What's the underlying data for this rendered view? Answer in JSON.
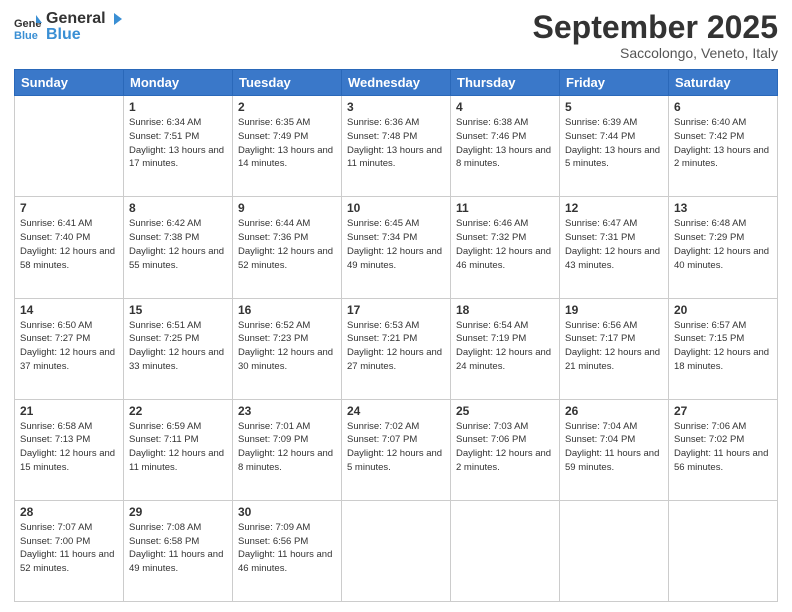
{
  "logo": {
    "general": "General",
    "blue": "Blue"
  },
  "header": {
    "month": "September 2025",
    "location": "Saccolongo, Veneto, Italy"
  },
  "days_of_week": [
    "Sunday",
    "Monday",
    "Tuesday",
    "Wednesday",
    "Thursday",
    "Friday",
    "Saturday"
  ],
  "weeks": [
    [
      {
        "day": null,
        "info": null
      },
      {
        "day": "1",
        "sunrise": "Sunrise: 6:34 AM",
        "sunset": "Sunset: 7:51 PM",
        "daylight": "Daylight: 13 hours and 17 minutes."
      },
      {
        "day": "2",
        "sunrise": "Sunrise: 6:35 AM",
        "sunset": "Sunset: 7:49 PM",
        "daylight": "Daylight: 13 hours and 14 minutes."
      },
      {
        "day": "3",
        "sunrise": "Sunrise: 6:36 AM",
        "sunset": "Sunset: 7:48 PM",
        "daylight": "Daylight: 13 hours and 11 minutes."
      },
      {
        "day": "4",
        "sunrise": "Sunrise: 6:38 AM",
        "sunset": "Sunset: 7:46 PM",
        "daylight": "Daylight: 13 hours and 8 minutes."
      },
      {
        "day": "5",
        "sunrise": "Sunrise: 6:39 AM",
        "sunset": "Sunset: 7:44 PM",
        "daylight": "Daylight: 13 hours and 5 minutes."
      },
      {
        "day": "6",
        "sunrise": "Sunrise: 6:40 AM",
        "sunset": "Sunset: 7:42 PM",
        "daylight": "Daylight: 13 hours and 2 minutes."
      }
    ],
    [
      {
        "day": "7",
        "sunrise": "Sunrise: 6:41 AM",
        "sunset": "Sunset: 7:40 PM",
        "daylight": "Daylight: 12 hours and 58 minutes."
      },
      {
        "day": "8",
        "sunrise": "Sunrise: 6:42 AM",
        "sunset": "Sunset: 7:38 PM",
        "daylight": "Daylight: 12 hours and 55 minutes."
      },
      {
        "day": "9",
        "sunrise": "Sunrise: 6:44 AM",
        "sunset": "Sunset: 7:36 PM",
        "daylight": "Daylight: 12 hours and 52 minutes."
      },
      {
        "day": "10",
        "sunrise": "Sunrise: 6:45 AM",
        "sunset": "Sunset: 7:34 PM",
        "daylight": "Daylight: 12 hours and 49 minutes."
      },
      {
        "day": "11",
        "sunrise": "Sunrise: 6:46 AM",
        "sunset": "Sunset: 7:32 PM",
        "daylight": "Daylight: 12 hours and 46 minutes."
      },
      {
        "day": "12",
        "sunrise": "Sunrise: 6:47 AM",
        "sunset": "Sunset: 7:31 PM",
        "daylight": "Daylight: 12 hours and 43 minutes."
      },
      {
        "day": "13",
        "sunrise": "Sunrise: 6:48 AM",
        "sunset": "Sunset: 7:29 PM",
        "daylight": "Daylight: 12 hours and 40 minutes."
      }
    ],
    [
      {
        "day": "14",
        "sunrise": "Sunrise: 6:50 AM",
        "sunset": "Sunset: 7:27 PM",
        "daylight": "Daylight: 12 hours and 37 minutes."
      },
      {
        "day": "15",
        "sunrise": "Sunrise: 6:51 AM",
        "sunset": "Sunset: 7:25 PM",
        "daylight": "Daylight: 12 hours and 33 minutes."
      },
      {
        "day": "16",
        "sunrise": "Sunrise: 6:52 AM",
        "sunset": "Sunset: 7:23 PM",
        "daylight": "Daylight: 12 hours and 30 minutes."
      },
      {
        "day": "17",
        "sunrise": "Sunrise: 6:53 AM",
        "sunset": "Sunset: 7:21 PM",
        "daylight": "Daylight: 12 hours and 27 minutes."
      },
      {
        "day": "18",
        "sunrise": "Sunrise: 6:54 AM",
        "sunset": "Sunset: 7:19 PM",
        "daylight": "Daylight: 12 hours and 24 minutes."
      },
      {
        "day": "19",
        "sunrise": "Sunrise: 6:56 AM",
        "sunset": "Sunset: 7:17 PM",
        "daylight": "Daylight: 12 hours and 21 minutes."
      },
      {
        "day": "20",
        "sunrise": "Sunrise: 6:57 AM",
        "sunset": "Sunset: 7:15 PM",
        "daylight": "Daylight: 12 hours and 18 minutes."
      }
    ],
    [
      {
        "day": "21",
        "sunrise": "Sunrise: 6:58 AM",
        "sunset": "Sunset: 7:13 PM",
        "daylight": "Daylight: 12 hours and 15 minutes."
      },
      {
        "day": "22",
        "sunrise": "Sunrise: 6:59 AM",
        "sunset": "Sunset: 7:11 PM",
        "daylight": "Daylight: 12 hours and 11 minutes."
      },
      {
        "day": "23",
        "sunrise": "Sunrise: 7:01 AM",
        "sunset": "Sunset: 7:09 PM",
        "daylight": "Daylight: 12 hours and 8 minutes."
      },
      {
        "day": "24",
        "sunrise": "Sunrise: 7:02 AM",
        "sunset": "Sunset: 7:07 PM",
        "daylight": "Daylight: 12 hours and 5 minutes."
      },
      {
        "day": "25",
        "sunrise": "Sunrise: 7:03 AM",
        "sunset": "Sunset: 7:06 PM",
        "daylight": "Daylight: 12 hours and 2 minutes."
      },
      {
        "day": "26",
        "sunrise": "Sunrise: 7:04 AM",
        "sunset": "Sunset: 7:04 PM",
        "daylight": "Daylight: 11 hours and 59 minutes."
      },
      {
        "day": "27",
        "sunrise": "Sunrise: 7:06 AM",
        "sunset": "Sunset: 7:02 PM",
        "daylight": "Daylight: 11 hours and 56 minutes."
      }
    ],
    [
      {
        "day": "28",
        "sunrise": "Sunrise: 7:07 AM",
        "sunset": "Sunset: 7:00 PM",
        "daylight": "Daylight: 11 hours and 52 minutes."
      },
      {
        "day": "29",
        "sunrise": "Sunrise: 7:08 AM",
        "sunset": "Sunset: 6:58 PM",
        "daylight": "Daylight: 11 hours and 49 minutes."
      },
      {
        "day": "30",
        "sunrise": "Sunrise: 7:09 AM",
        "sunset": "Sunset: 6:56 PM",
        "daylight": "Daylight: 11 hours and 46 minutes."
      },
      {
        "day": null,
        "info": null
      },
      {
        "day": null,
        "info": null
      },
      {
        "day": null,
        "info": null
      },
      {
        "day": null,
        "info": null
      }
    ]
  ]
}
